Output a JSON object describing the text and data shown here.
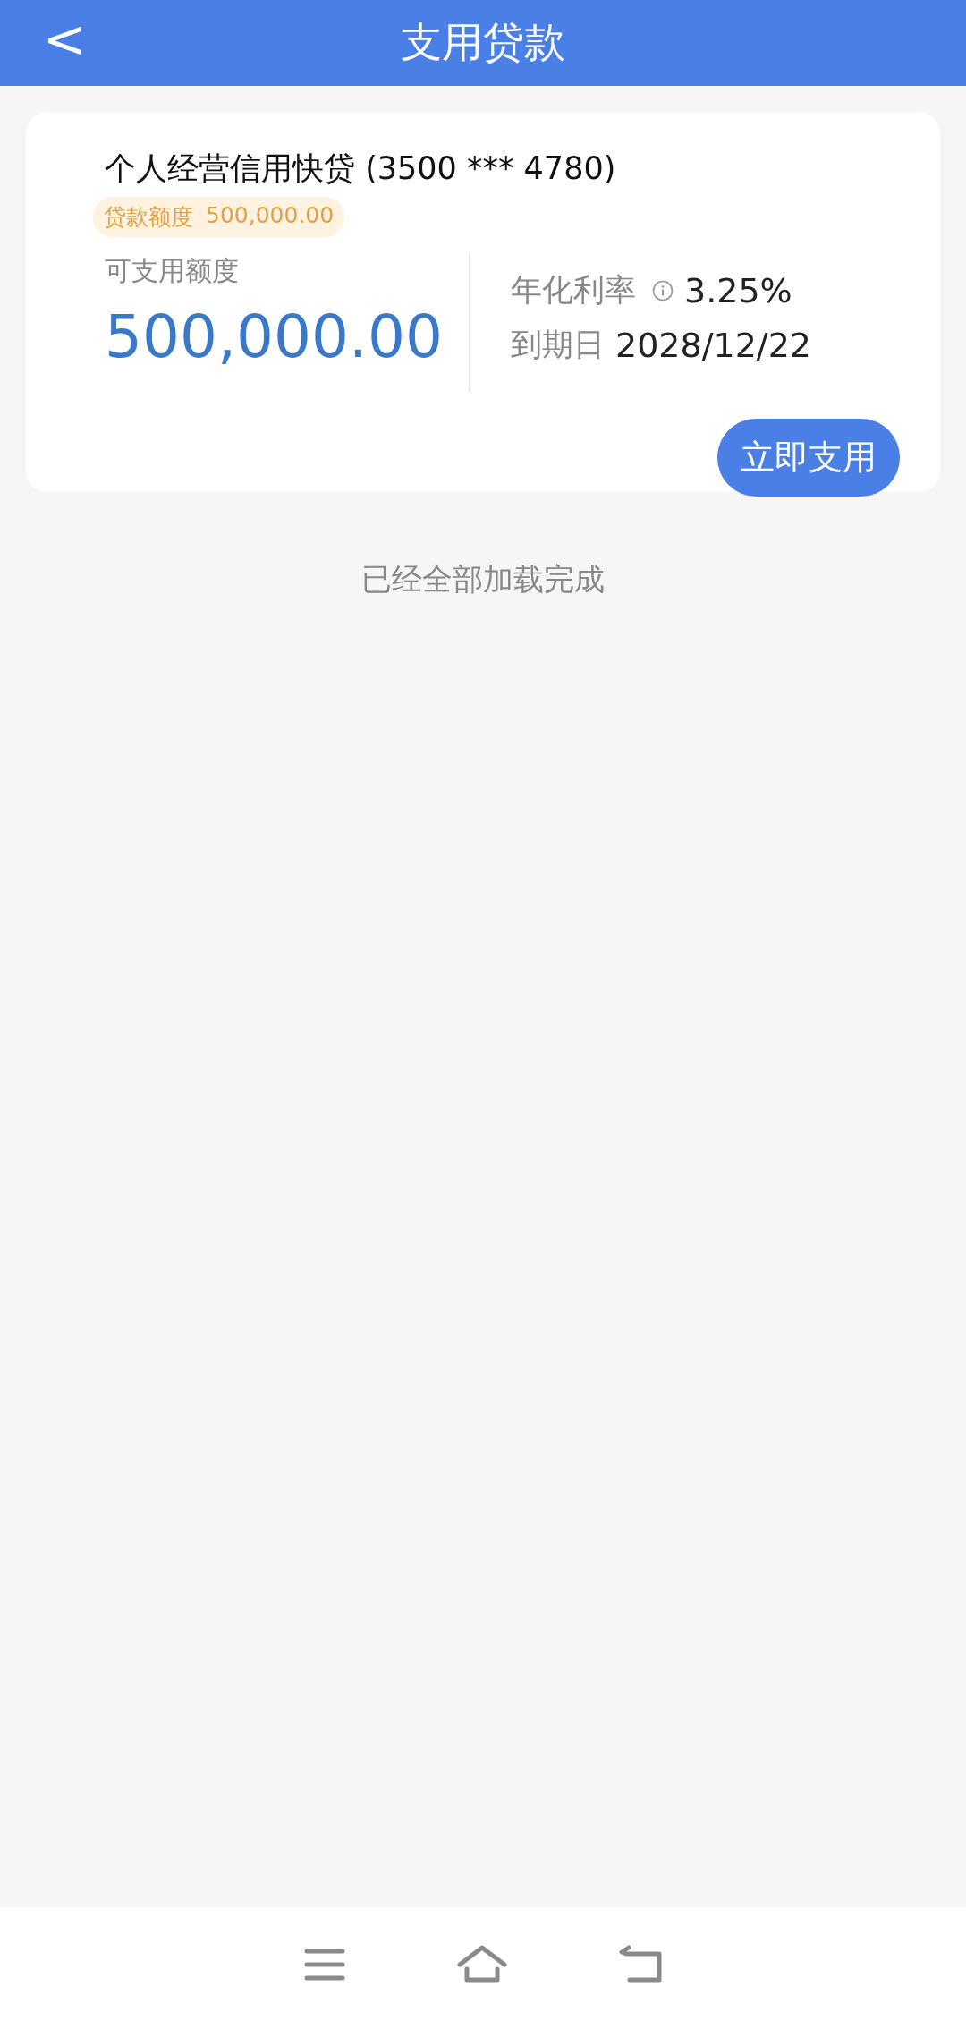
{
  "header": {
    "back": "<",
    "title": "支用贷款"
  },
  "loans": [
    {
      "name": "个人经营信用快贷 (3500 *** 4780)",
      "limit_label": "贷款额度",
      "limit": "500,000.00",
      "available_label": "可支用额度",
      "available": "500,000.00",
      "rate_label": "年化利率",
      "rate": "3.25%",
      "due_label": "到期日",
      "due": "2028/12/22",
      "action": "立即支用"
    }
  ],
  "footer_note": "已经全部加载完成",
  "nav_bar": {
    "buttons": [
      {
        "kind": "menu"
      },
      {
        "kind": "home"
      },
      {
        "kind": "back"
      }
    ]
  }
}
